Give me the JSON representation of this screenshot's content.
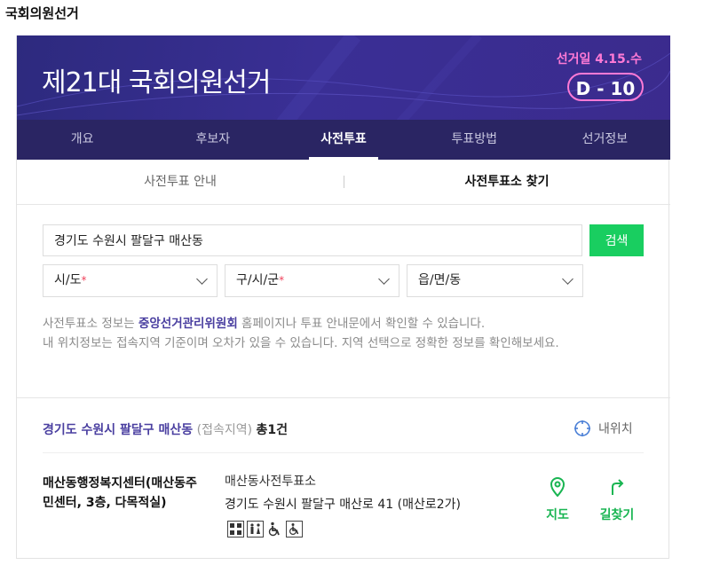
{
  "page_title": "국회의원선거",
  "banner": {
    "title": "제21대 국회의원선거",
    "election_date": "선거일 4.15.수",
    "dday": "D - 10"
  },
  "nav": {
    "items": [
      {
        "label": "개요"
      },
      {
        "label": "후보자"
      },
      {
        "label": "사전투표"
      },
      {
        "label": "투표방법"
      },
      {
        "label": "선거정보"
      }
    ],
    "active_index": 2
  },
  "subtabs": {
    "items": [
      {
        "label": "사전투표 안내"
      },
      {
        "label": "사전투표소 찾기"
      }
    ],
    "active_index": 1
  },
  "search": {
    "value": "경기도 수원시 팔달구 매산동",
    "button_label": "검색"
  },
  "selects": [
    {
      "label": "시/도",
      "required": "*"
    },
    {
      "label": "구/시/군",
      "required": "*"
    },
    {
      "label": "읍/면/동",
      "required": ""
    }
  ],
  "info": {
    "line1_prefix": "사전투표소 정보는 ",
    "line1_link": "중앙선거관리위원회",
    "line1_suffix": " 홈페이지나 투표 안내문에서 확인할 수 있습니다.",
    "line2": "내 위치정보는 접속지역 기준이며 오차가 있을 수 있습니다. 지역 선택으로 정확한 정보를 확인해보세요."
  },
  "result": {
    "location": "경기도 수원시 팔달구 매산동",
    "location_note": "(접속지역)",
    "count": "총1건",
    "my_location_label": "내위치"
  },
  "place": {
    "name": "매산동행정복지센터(매산동주민센터, 3층, 다목적실)",
    "title": "매산동사전투표소",
    "address": "경기도 수원시 팔달구 매산로 41 (매산로2가)",
    "facility_icons": [
      "parking-icon",
      "restroom-icon",
      "wheelchair-icon",
      "accessible-icon"
    ],
    "map_label": "지도",
    "route_label": "길찾기"
  },
  "colors": {
    "banner": "#3a2f95",
    "nav": "#2a2563",
    "accent": "#ff7ad6",
    "green": "#19ce60",
    "link": "#4a3fa0"
  }
}
